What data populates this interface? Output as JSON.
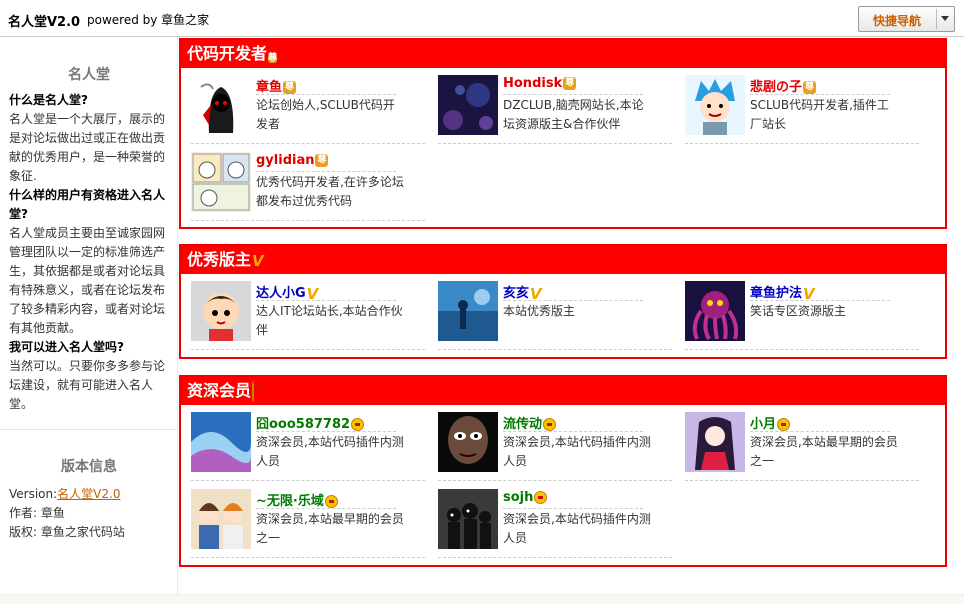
{
  "header": {
    "title": "名人堂V2.0",
    "powered": "powered by 章鱼之家",
    "nav_button": "快捷导航"
  },
  "sidebar": {
    "heading": "名人堂",
    "q1": "什么是名人堂?",
    "a1": "名人堂是一个大展厅，展示的是对论坛做出过或正在做出贡献的优秀用户，是一种荣誉的象征.",
    "q2": "什么样的用户有资格进入名人堂?",
    "a2": "名人堂成员主要由至诚家园网管理团队以一定的标准筛选产生，其依据都是或者对论坛具有特殊意义，或者在论坛发布了较多精彩内容，或者对论坛有其他贡献。",
    "q3": "我可以进入名人堂吗?",
    "a3": "当然可以。只要你多多参与论坛建设，就有可能进入名人堂。",
    "version_heading": "版本信息",
    "version_label": "Version:",
    "version_value": "名人堂V2.0",
    "author_label": "作者:",
    "author_value": "章鱼",
    "copyright_label": "版权:",
    "copyright_value": "章鱼之家代码站"
  },
  "sections": [
    {
      "title": "代码开发者",
      "badge": "尊",
      "badge_type": "zun",
      "members": [
        {
          "name": "章鱼",
          "badge": "尊",
          "desc": "论坛创始人,SCLUB代码开发者",
          "avatar": "hooded-red-figure"
        },
        {
          "name": "Hondisk",
          "badge": "尊",
          "desc": "DZCLUB,脑壳网站长,本论坛资源版主&合作伙伴",
          "avatar": "purple-bokeh"
        },
        {
          "name": "悲剧の子",
          "badge": "尊",
          "desc": "SCLUB代码开发者,插件工厂站长",
          "avatar": "blue-hair-boy"
        },
        {
          "name": "gylidian",
          "badge": "尊",
          "desc": "优秀代码开发者,在许多论坛都发布过优秀代码",
          "avatar": "cartoon-comic"
        }
      ]
    },
    {
      "title": "优秀版主",
      "badge": "V",
      "badge_type": "v",
      "members": [
        {
          "name": "达人小G",
          "badge": "V",
          "desc": "达人IT论坛站长,本站合作伙伴",
          "avatar": "cartoon-kid"
        },
        {
          "name": "亥亥",
          "badge": "V",
          "desc": "本站优秀版主",
          "avatar": "blue-fantasy"
        },
        {
          "name": "章鱼护法",
          "badge": "V",
          "desc": "笑话专区资源版主",
          "avatar": "octopus"
        }
      ]
    },
    {
      "title": "资深会员",
      "badge": "crown",
      "badge_type": "crown",
      "members": [
        {
          "name": "囧ooo587782",
          "badge": "crown",
          "desc": "资深会员,本站代码插件内测人员",
          "avatar": "blue-wave"
        },
        {
          "name": "流传动",
          "badge": "crown",
          "desc": "资深会员,本站代码插件内测人员",
          "avatar": "dark-eye"
        },
        {
          "name": "小月",
          "badge": "crown",
          "desc": "资深会员,本站最早期的会员之一",
          "avatar": "anime-girl"
        },
        {
          "name": "~无限·乐域",
          "badge": "crown",
          "desc": "资深会员,本站最早期的会员之一",
          "avatar": "anime-group"
        },
        {
          "name": "sojh",
          "badge": "crown",
          "desc": "资深会员,本站代码插件内测人员",
          "avatar": "dark-figures"
        }
      ]
    }
  ]
}
